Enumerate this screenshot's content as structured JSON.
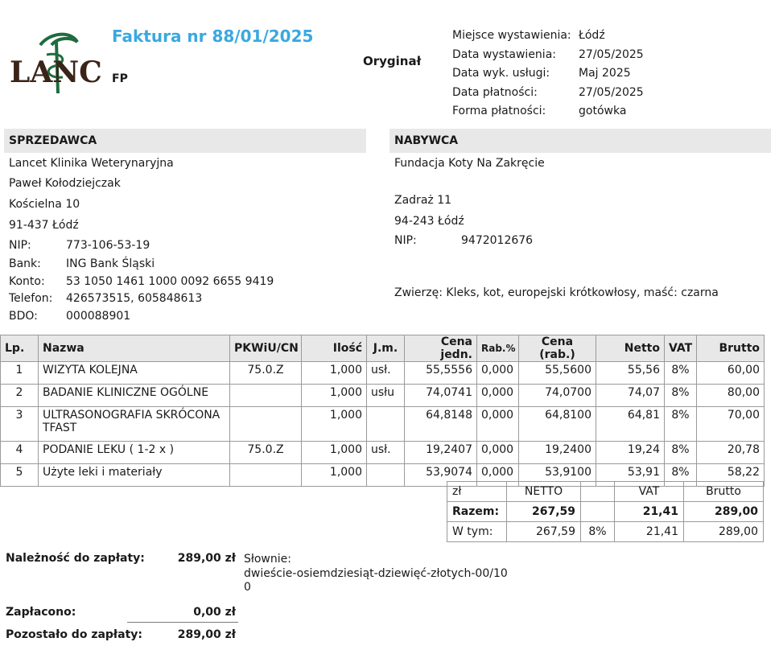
{
  "logo": {
    "text": "LANCET",
    "colors": {
      "letters": "#3a2418",
      "accent": "#1f6b3f"
    }
  },
  "header": {
    "title": "Faktura nr 88/01/2025",
    "subtitle": "FP",
    "original": "Oryginał"
  },
  "meta": [
    {
      "label": "Miejsce wystawienia:",
      "value": "Łódź"
    },
    {
      "label": "Data wystawienia:",
      "value": "27/05/2025"
    },
    {
      "label": "Data wyk. usługi:",
      "value": "Maj 2025"
    },
    {
      "label": "Data płatności:",
      "value": "27/05/2025"
    },
    {
      "label": "Forma płatności:",
      "value": "gotówka"
    }
  ],
  "seller": {
    "heading": "SPRZEDAWCA",
    "name": "Lancet Klinika Weterynaryjna",
    "owner": "Paweł Kołodziejczak",
    "street": "Kościelna 10",
    "city": "91-437 Łódź",
    "fields": [
      {
        "label": "NIP:",
        "value": "773-106-53-19"
      },
      {
        "label": "Bank:",
        "value": "ING Bank Śląski"
      },
      {
        "label": "Konto:",
        "value": "53 1050 1461 1000 0092 6655 9419"
      },
      {
        "label": "Telefon:",
        "value": "426573515,  605848613"
      },
      {
        "label": "BDO:",
        "value": "000088901"
      }
    ]
  },
  "buyer": {
    "heading": "NABYWCA",
    "name": "Fundacja Koty Na Zakręcie",
    "street": "Zadraż 11",
    "city": "94-243 Łódź",
    "nip_label": "NIP:",
    "nip": "9472012676",
    "animal": "Zwierzę: Kleks, kot, europejski krótkowłosy, maść: czarna"
  },
  "items": {
    "headers": [
      "Lp.",
      "Nazwa",
      "PKWiU/CN",
      "Ilość",
      "J.m.",
      "Cena jedn.",
      "Rab.%",
      "Cena (rab.)",
      "Netto",
      "VAT",
      "Brutto"
    ],
    "rows": [
      {
        "lp": "1",
        "name": "WIZYTA KOLEJNA",
        "pkwiu": "75.0.Z",
        "qty": "1,000",
        "unit": "usł.",
        "price": "55,5556",
        "disc": "0,000",
        "price_disc": "55,5600",
        "net": "55,56",
        "vat": "8%",
        "gross": "60,00"
      },
      {
        "lp": "2",
        "name": "BADANIE KLINICZNE  OGÓLNE",
        "pkwiu": "",
        "qty": "1,000",
        "unit": "usłu",
        "price": "74,0741",
        "disc": "0,000",
        "price_disc": "74,0700",
        "net": "74,07",
        "vat": "8%",
        "gross": "80,00"
      },
      {
        "lp": "3",
        "name": "ULTRASONOGRAFIA SKRÓCONA TFAST",
        "pkwiu": "",
        "qty": "1,000",
        "unit": "",
        "price": "64,8148",
        "disc": "0,000",
        "price_disc": "64,8100",
        "net": "64,81",
        "vat": "8%",
        "gross": "70,00"
      },
      {
        "lp": "4",
        "name": "PODANIE  LEKU ( 1-2 x )",
        "pkwiu": "75.0.Z",
        "qty": "1,000",
        "unit": "usł.",
        "price": "19,2407",
        "disc": "0,000",
        "price_disc": "19,2400",
        "net": "19,24",
        "vat": "8%",
        "gross": "20,78"
      },
      {
        "lp": "5",
        "name": "Użyte leki i materiały",
        "pkwiu": "",
        "qty": "1,000",
        "unit": "",
        "price": "53,9074",
        "disc": "0,000",
        "price_disc": "53,9100",
        "net": "53,91",
        "vat": "8%",
        "gross": "58,22"
      }
    ]
  },
  "totals": {
    "currency": "zł",
    "col_net": "NETTO",
    "col_vat": "VAT",
    "col_gross": "Brutto",
    "sum_label": "Razem:",
    "sum_net": "267,59",
    "sum_vat": "21,41",
    "sum_gross": "289,00",
    "incl_label": "W tym:",
    "incl_net": "267,59",
    "incl_rate": "8%",
    "incl_vat": "21,41",
    "incl_gross": "289,00"
  },
  "payment": {
    "due_label": "Należność do zapłaty:",
    "due_value": "289,00 zł",
    "words_label": "Słownie:",
    "words_line1": "dwieście-osiemdziesiąt-dziewięć-złotych-00/10",
    "words_line2": "0",
    "paid_label": "Zapłacono:",
    "paid_value": "0,00 zł",
    "left_label": "Pozostało do zapłaty:",
    "left_value": "289,00 zł"
  }
}
